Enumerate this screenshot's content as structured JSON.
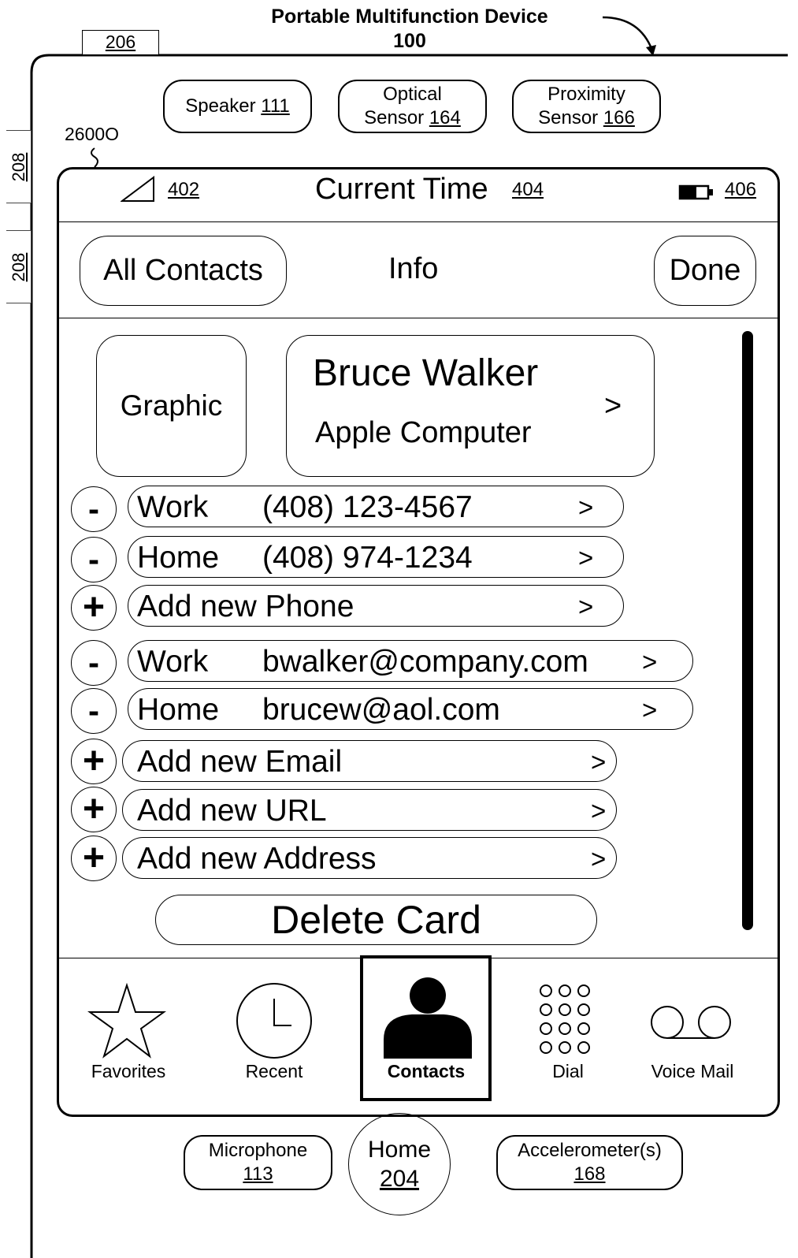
{
  "device": {
    "title": "Portable Multifunction Device",
    "number": "100",
    "ref_top": "206",
    "ref_side_1": "208",
    "ref_side_2": "208",
    "ref_screen": "2600O"
  },
  "sensors": {
    "speaker": {
      "label": "Speaker",
      "num": "111"
    },
    "optical": {
      "line1": "Optical",
      "line2": "Sensor",
      "num": "164"
    },
    "proximity": {
      "line1": "Proximity",
      "line2": "Sensor",
      "num": "166"
    }
  },
  "status_bar": {
    "signal_ref": "402",
    "time": "Current Time",
    "time_ref": "404",
    "battery_ref": "406"
  },
  "nav": {
    "back_label": "All Contacts",
    "title": "Info",
    "done_label": "Done"
  },
  "contact": {
    "graphic_label": "Graphic",
    "name": "Bruce Walker",
    "company": "Apple Computer",
    "chevron": ">"
  },
  "fields": [
    {
      "control": "-",
      "label": "Work",
      "value": "(408) 123-4567",
      "chevron": ">"
    },
    {
      "control": "-",
      "label": "Home",
      "value": "(408) 974-1234",
      "chevron": ">"
    },
    {
      "control": "+",
      "label": "Add new Phone",
      "value": "",
      "chevron": ">"
    },
    {
      "control": "-",
      "label": "Work",
      "value": "bwalker@company.com",
      "chevron": ">"
    },
    {
      "control": "-",
      "label": "Home",
      "value": "brucew@aol.com",
      "chevron": ">"
    },
    {
      "control": "+",
      "label": "Add new Email",
      "value": "",
      "chevron": ">"
    },
    {
      "control": "+",
      "label": "Add new URL",
      "value": "",
      "chevron": ">"
    },
    {
      "control": "+",
      "label": "Add new Address",
      "value": "",
      "chevron": ">"
    }
  ],
  "delete_label": "Delete Card",
  "tabs": [
    {
      "label": "Favorites",
      "icon": "star-icon"
    },
    {
      "label": "Recent",
      "icon": "clock-icon"
    },
    {
      "label": "Contacts",
      "icon": "person-icon",
      "selected": true
    },
    {
      "label": "Dial",
      "icon": "keypad-icon"
    },
    {
      "label": "Voice Mail",
      "icon": "voicemail-icon"
    }
  ],
  "hardware": {
    "microphone": {
      "label": "Microphone",
      "num": "113"
    },
    "home": {
      "label": "Home",
      "num": "204"
    },
    "accelerometer": {
      "label": "Accelerometer(s)",
      "num": "168"
    }
  }
}
